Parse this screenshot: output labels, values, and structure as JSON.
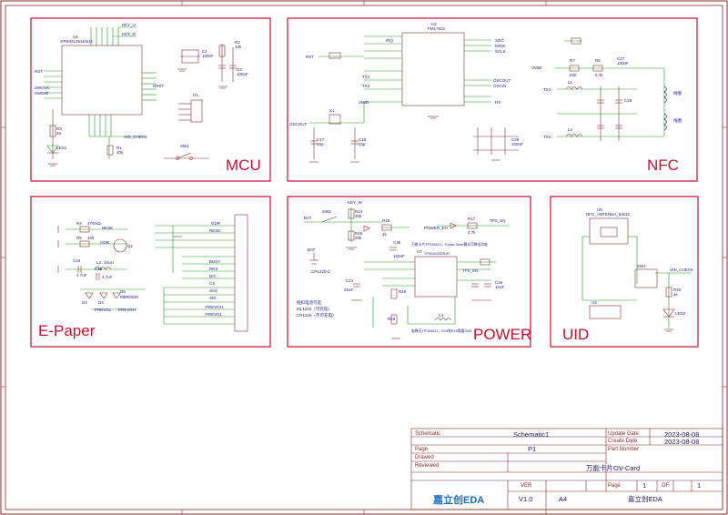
{
  "blocks": {
    "mcu": "MCU",
    "nfc": "NFC",
    "epaper": "E-Paper",
    "power": "POWER",
    "uid": "UID"
  },
  "title_block": {
    "schematic_label": "Schematic",
    "schematic_value": "Schematic1",
    "page_label": "Page",
    "page_value": "P1",
    "drawed_label": "Drawed",
    "reviewed_label": "Reviewed",
    "project_title": "万能卡片OV-Card",
    "update_date_label": "Update Date",
    "update_date_value": "2023-08-08",
    "create_date_label": "Create Date",
    "create_date_value": "2023-08-08",
    "part_number_label": "Part Number",
    "ver_label": "VER",
    "ver_value": "V1.0",
    "size_value": "A4",
    "page_num_label": "Page",
    "page_num": "1",
    "of_label": "OF",
    "page_total": "1",
    "company": "嘉立创EDA",
    "logo_text": "嘉立创EDA"
  },
  "mcu": {
    "u1_ref": "U1",
    "u1_part": "STM32L051K6U6",
    "key_u": "KEY_U",
    "key_d": "KEY_D",
    "rst": "RST",
    "swclk": "SWCLK",
    "swdio": "SWDIO",
    "nrst": "NRST",
    "uid_check": "UID_CHECK",
    "led_ref": "LED1",
    "c1": "C1",
    "c1_val": "100nF",
    "c4": "C4",
    "c4_val": "100nF",
    "r2": "R2",
    "r2_val": "10k",
    "r1": "R1",
    "r1_val": "10k",
    "r3": "R3",
    "r3_val": "2K",
    "h1": "H1",
    "sw1": "SW1"
  },
  "nfc": {
    "u2_ref": "U2",
    "u2_part": "FM17522",
    "irq": "IRQ",
    "sdo": "SDO",
    "mosi": "MOSI",
    "sclk": "SCLK",
    "oscout": "OSCOUT",
    "oscin": "OSCIN",
    "rx": "RX",
    "tx1": "TX1",
    "tx2": "TX2",
    "vmid": "VMID",
    "rst": "RST",
    "l1": "L1",
    "l2": "L2",
    "r7": "R7",
    "r7_val": "820",
    "r6": "R6",
    "r6_val": "2.7k",
    "c27": "C27",
    "c27_val": "100nF",
    "c28": "C28",
    "c29": "C29",
    "c29_val": "100nF",
    "x1": "X1",
    "c17": "C17",
    "c17_val": "15p",
    "c18": "C18",
    "c18_val": "15p",
    "ant1": "线圈",
    "ant2": "线圈"
  },
  "epaper": {
    "r4": "R4",
    "r4_val": "470mΩ",
    "r5": "R5",
    "r5_val": "10k",
    "q1": "Q1",
    "l3": "L3",
    "l3_val": "10uH",
    "c16": "C16",
    "c16_val": "4.7uF",
    "c15": "C15",
    "c15_val": "4.7uF",
    "d3": "D3",
    "d4": "D4",
    "d5": "D5",
    "d5_part": "MBR0530",
    "gdr": "GDR",
    "rese": "RESE",
    "prevgl": "PREVGL",
    "prevgh": "PREVGH",
    "busy": "BUSY",
    "res": "RES",
    "dc": "D/C",
    "cs": "CS",
    "sck": "SCK",
    "sdi": "SDI",
    "vdd": "VDD"
  },
  "power": {
    "bat": "BAT",
    "sw2": "SW2",
    "key_w": "KEY_W",
    "r14": "R14",
    "r14_val": "20k",
    "r15": "R15",
    "r15_val": "20k",
    "r16": "R16",
    "r16_val": "1k",
    "power_en": "POWER_EN",
    "r17": "R17",
    "r17_val": "4.7k",
    "tps_en": "TPS_EN",
    "u7": "U7",
    "u7_part": "TPS63020DSJR",
    "note_top": "万能卡片TPS63021，Power Save模式可降低功耗",
    "note_bot": "若降压TPS63021，R19和R18需要DNS",
    "batt_ref": "BAT",
    "batt_part": "CR1220-2",
    "batt_note1": "纽扣电池可选：",
    "batt_note2": "ML1220（可充电）",
    "batt_note3": "CR1220（不可充电）",
    "c21": "C21",
    "c21_val": "22uF",
    "c26": "C26",
    "c26_val": "10uF",
    "r19": "R19",
    "r18": "R18",
    "l4": "L4",
    "c35": "C35",
    "c35_val": "100nF"
  },
  "uid": {
    "u5": "U5",
    "antenna": "NFC_ANTENNA_53x22",
    "sw4": "SW4",
    "u3": "U3",
    "uid_check": "UID_CHECK",
    "r15": "R15",
    "r15_val": "1k",
    "led2": "LED2"
  }
}
